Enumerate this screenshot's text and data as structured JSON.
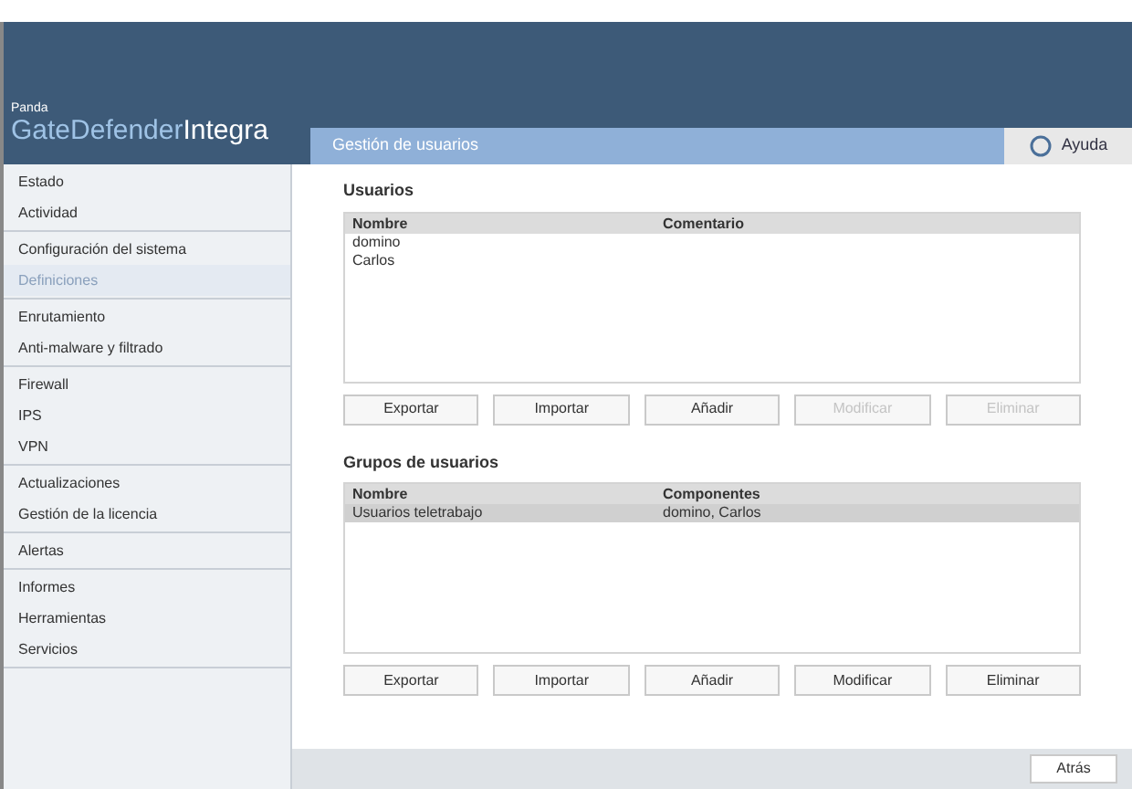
{
  "logo": {
    "brand": "Panda",
    "product_prefix": "GateDefender",
    "product_suffix": "Integra"
  },
  "page_title": "Gestión de usuarios",
  "help_button": "Ayuda",
  "sidebar": {
    "groups": [
      {
        "items": [
          {
            "label": "Estado",
            "selected": false
          },
          {
            "label": "Actividad",
            "selected": false
          }
        ]
      },
      {
        "items": [
          {
            "label": "Configuración del sistema",
            "selected": false
          },
          {
            "label": "Definiciones",
            "selected": true
          }
        ]
      },
      {
        "items": [
          {
            "label": "Enrutamiento",
            "selected": false
          },
          {
            "label": "Anti-malware y filtrado",
            "selected": false
          }
        ]
      },
      {
        "items": [
          {
            "label": "Firewall",
            "selected": false
          },
          {
            "label": "IPS",
            "selected": false
          },
          {
            "label": "VPN",
            "selected": false
          }
        ]
      },
      {
        "items": [
          {
            "label": "Actualizaciones",
            "selected": false
          },
          {
            "label": "Gestión de la licencia",
            "selected": false
          }
        ]
      },
      {
        "items": [
          {
            "label": "Alertas",
            "selected": false
          }
        ]
      },
      {
        "items": [
          {
            "label": "Informes",
            "selected": false
          },
          {
            "label": "Herramientas",
            "selected": false
          },
          {
            "label": "Servicios",
            "selected": false
          }
        ]
      }
    ]
  },
  "sections": [
    {
      "title": "Usuarios",
      "columns": [
        "Nombre",
        "Comentario"
      ],
      "rows": [
        {
          "cells": [
            "domino",
            ""
          ],
          "selected": false
        },
        {
          "cells": [
            "Carlos",
            ""
          ],
          "selected": false
        }
      ],
      "buttons": [
        {
          "label": "Exportar",
          "disabled": false
        },
        {
          "label": "Importar",
          "disabled": false
        },
        {
          "label": "Añadir",
          "disabled": false
        },
        {
          "label": "Modificar",
          "disabled": true
        },
        {
          "label": "Eliminar",
          "disabled": true
        }
      ]
    },
    {
      "title": "Grupos de usuarios",
      "columns": [
        "Nombre",
        "Componentes"
      ],
      "rows": [
        {
          "cells": [
            "Usuarios teletrabajo",
            "domino, Carlos"
          ],
          "selected": true
        }
      ],
      "buttons": [
        {
          "label": "Exportar",
          "disabled": false
        },
        {
          "label": "Importar",
          "disabled": false
        },
        {
          "label": "Añadir",
          "disabled": false
        },
        {
          "label": "Modificar",
          "disabled": false
        },
        {
          "label": "Eliminar",
          "disabled": false
        }
      ]
    }
  ],
  "back_button": "Atrás"
}
